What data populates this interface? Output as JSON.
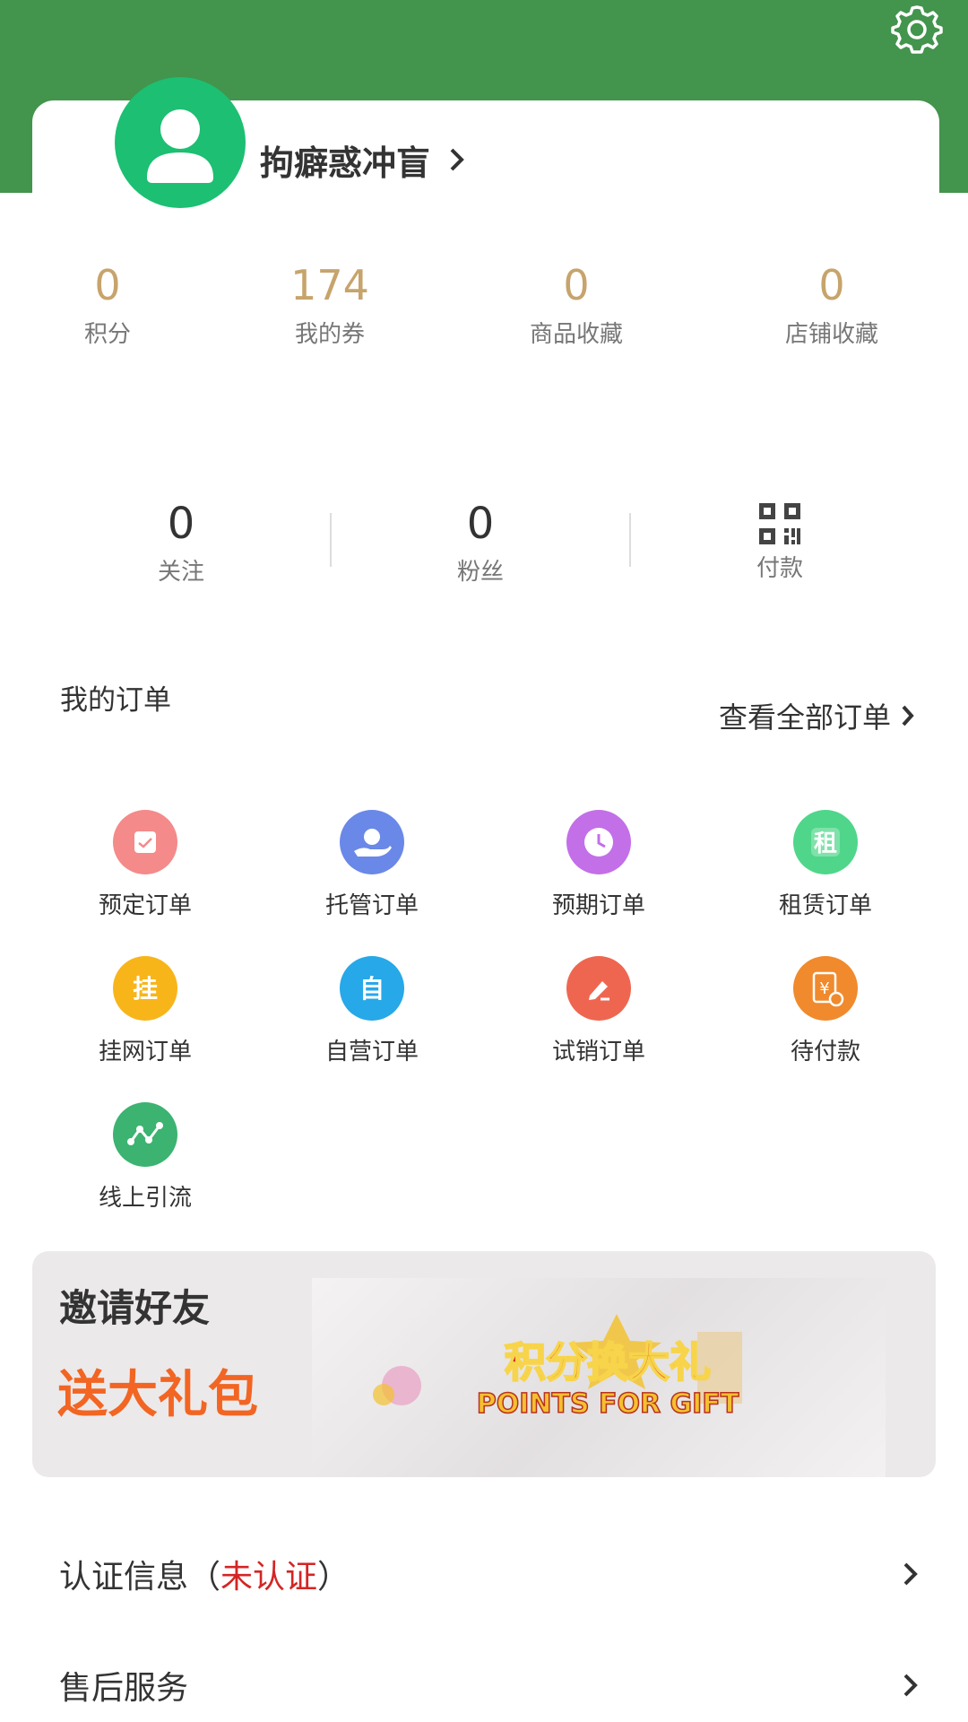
{
  "profile": {
    "username": "拘癖惑冲盲"
  },
  "stats": [
    {
      "value": "0",
      "label": "积分"
    },
    {
      "value": "174",
      "label": "我的券"
    },
    {
      "value": "0",
      "label": "商品收藏"
    },
    {
      "value": "0",
      "label": "店铺收藏"
    }
  ],
  "social": {
    "follow": {
      "value": "0",
      "label": "关注"
    },
    "fans": {
      "value": "0",
      "label": "粉丝"
    },
    "pay": {
      "label": "付款"
    }
  },
  "orders": {
    "title": "我的订单",
    "view_all": "查看全部订单",
    "items": [
      {
        "label": "预定订单",
        "icon": "reserve-order-icon",
        "color": "#f48a8a"
      },
      {
        "label": "托管订单",
        "icon": "custody-order-icon",
        "color": "#6a88e8"
      },
      {
        "label": "预期订单",
        "icon": "expected-order-icon",
        "color": "#c36fe8"
      },
      {
        "label": "租赁订单",
        "icon": "lease-order-icon",
        "color": "#4fd68a",
        "glyph": "租"
      },
      {
        "label": "挂网订单",
        "icon": "listing-order-icon",
        "color": "#f8b51a",
        "glyph": "挂"
      },
      {
        "label": "自营订单",
        "icon": "self-operated-order-icon",
        "color": "#27a8e8",
        "glyph": "自"
      },
      {
        "label": "试销订单",
        "icon": "trial-sale-order-icon",
        "color": "#ef6650"
      },
      {
        "label": "待付款",
        "icon": "pending-payment-icon",
        "color": "#f08a2d"
      },
      {
        "label": "线上引流",
        "icon": "online-traffic-icon",
        "color": "#3cb371"
      }
    ]
  },
  "banner": {
    "title": "邀请好友",
    "subtitle": "送大礼包",
    "art_main": "积分换大礼",
    "art_sub": "POINTS FOR GIFT"
  },
  "menu": [
    {
      "label": "认证信息（",
      "status": "未认证",
      "suffix": "）"
    },
    {
      "label": "售后服务"
    }
  ],
  "colors": {
    "brand_green": "#43944d",
    "stat_gold": "#c7a46b",
    "banner_orange": "#f26522",
    "unverified_red": "#d42525"
  }
}
